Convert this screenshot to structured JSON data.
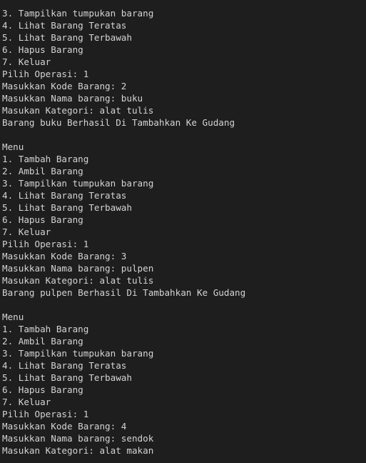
{
  "terminal": {
    "lines": [
      "3. Tampilkan tumpukan barang",
      "4. Lihat Barang Teratas",
      "5. Lihat Barang Terbawah",
      "6. Hapus Barang",
      "7. Keluar",
      "Pilih Operasi: 1",
      "Masukkan Kode Barang: 2",
      "Masukkan Nama barang: buku",
      "Masukan Kategori: alat tulis",
      "Barang buku Berhasil Di Tambahkan Ke Gudang",
      "",
      "Menu",
      "1. Tambah Barang",
      "2. Ambil Barang",
      "3. Tampilkan tumpukan barang",
      "4. Lihat Barang Teratas",
      "5. Lihat Barang Terbawah",
      "6. Hapus Barang",
      "7. Keluar",
      "Pilih Operasi: 1",
      "Masukkan Kode Barang: 3",
      "Masukkan Nama barang: pulpen",
      "Masukan Kategori: alat tulis",
      "Barang pulpen Berhasil Di Tambahkan Ke Gudang",
      "",
      "Menu",
      "1. Tambah Barang",
      "2. Ambil Barang",
      "3. Tampilkan tumpukan barang",
      "4. Lihat Barang Teratas",
      "5. Lihat Barang Terbawah",
      "6. Hapus Barang",
      "7. Keluar",
      "Pilih Operasi: 1",
      "Masukkan Kode Barang: 4",
      "Masukkan Nama barang: sendok",
      "Masukan Kategori: alat makan"
    ]
  }
}
